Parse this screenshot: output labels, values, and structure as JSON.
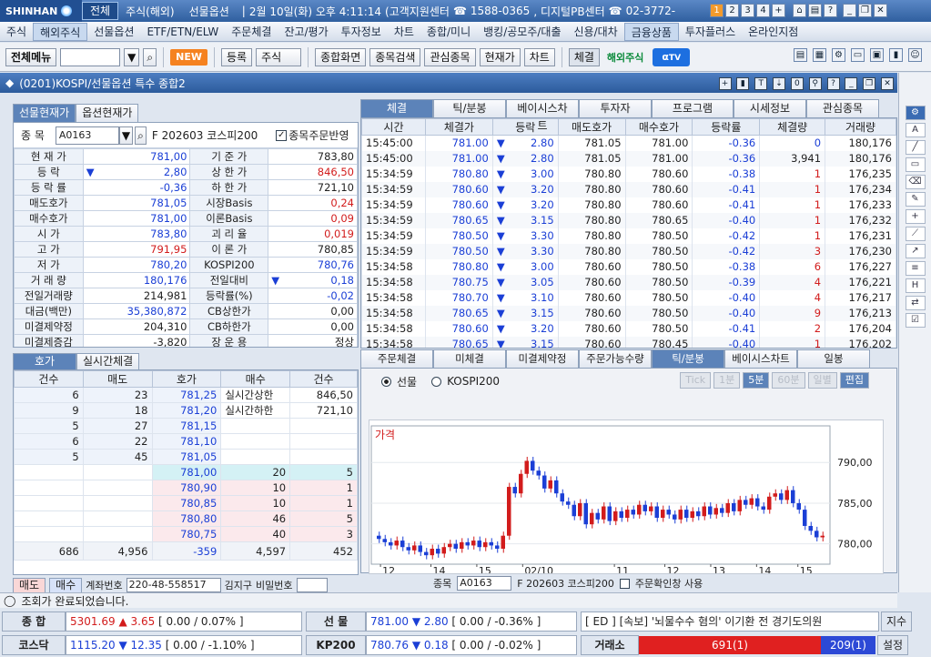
{
  "titlebar": {
    "brand": "SHINHAN",
    "menus": [
      "전체",
      "주식(해외)",
      "선물옵션"
    ],
    "datetime": "2월 10일(화) 오후 4:11:14",
    "center": "(고객지원센터",
    "phone1": "1588-0365",
    "pb": ", 디지털PB센터",
    "phone2": "02-3772-",
    "nums": [
      "1",
      "2",
      "3",
      "4",
      "+"
    ]
  },
  "menubar": [
    "주식",
    "해외주식",
    "선물옵션",
    "ETF/ETN/ELW",
    "주문체결",
    "잔고/평가",
    "투자정보",
    "차트",
    "종합/미니",
    "뱅킹/공모주/대출",
    "신용/대차",
    "금융상품",
    "투자플러스",
    "온라인지점"
  ],
  "toolbar": {
    "all_menu": "전체메뉴",
    "new": "NEW",
    "register": "등록",
    "market": "주식",
    "buttons": [
      "종합화면",
      "종목검색",
      "관심종목",
      "현재가",
      "차트"
    ],
    "check": "체결",
    "overseas": "해외주식",
    "alpha": "TV"
  },
  "window": {
    "title": "(0201)KOSPI/선물옵션 특수 종합2"
  },
  "left_tabs": [
    "선물현재가",
    "옵션현재가"
  ],
  "code": {
    "label": "종 목",
    "value": "A0163",
    "name": "F 202603 코스피200",
    "checkbox": "종목주문반영"
  },
  "quote": [
    [
      "현 재 가",
      "781,00",
      "기 준 가",
      "783,80"
    ],
    [
      "등    락",
      "2,80",
      "상 한 가",
      "846,50"
    ],
    [
      "등 락 률",
      "-0,36",
      "하 한 가",
      "721,10"
    ],
    [
      "매도호가",
      "781,05",
      "시장Basis",
      "0,24"
    ],
    [
      "매수호가",
      "781,00",
      "이론Basis",
      "0,09"
    ],
    [
      "시    가",
      "783,80",
      "괴 리 율",
      "0,019"
    ],
    [
      "고    가",
      "791,95",
      "이 론 가",
      "780,85"
    ],
    [
      "저    가",
      "780,20",
      "KOSPI200",
      "780,76"
    ],
    [
      "거 래 량",
      "180,176",
      "전일대비",
      "0,18"
    ],
    [
      "전일거래량",
      "214,981",
      "등락률(%)",
      "-0,02"
    ],
    [
      "대금(백만)",
      "35,380,872",
      "CB상한가",
      "0,00"
    ],
    [
      "미결제약정",
      "204,310",
      "CB하한가",
      "0,00"
    ],
    [
      "미결제증감",
      "-3,820",
      "장 운 용",
      "정상"
    ]
  ],
  "right_tabs": [
    "체결",
    "틱/분봉",
    "베이시스차트",
    "투자자",
    "프로그램",
    "시세정보",
    "관심종목"
  ],
  "trade_headers": [
    "시간",
    "체결가",
    "등락",
    "매도호가",
    "매수호가",
    "등락률",
    "체결량",
    "거래량"
  ],
  "trades": [
    [
      "15:45:00",
      "781.00",
      "2.80",
      "781.05",
      "781.00",
      "-0.36",
      "0",
      "180,176"
    ],
    [
      "15:45:00",
      "781.00",
      "2.80",
      "781.05",
      "781.00",
      "-0.36",
      "3,941",
      "180,176"
    ],
    [
      "15:34:59",
      "780.80",
      "3.00",
      "780.80",
      "780.60",
      "-0.38",
      "1",
      "176,235"
    ],
    [
      "15:34:59",
      "780.60",
      "3.20",
      "780.80",
      "780.60",
      "-0.41",
      "1",
      "176,234"
    ],
    [
      "15:34:59",
      "780.60",
      "3.20",
      "780.80",
      "780.60",
      "-0.41",
      "1",
      "176,233"
    ],
    [
      "15:34:59",
      "780.65",
      "3.15",
      "780.80",
      "780.65",
      "-0.40",
      "1",
      "176,232"
    ],
    [
      "15:34:59",
      "780.50",
      "3.30",
      "780.80",
      "780.50",
      "-0.42",
      "1",
      "176,231"
    ],
    [
      "15:34:59",
      "780.50",
      "3.30",
      "780.80",
      "780.50",
      "-0.42",
      "3",
      "176,230"
    ],
    [
      "15:34:58",
      "780.80",
      "3.00",
      "780.60",
      "780.50",
      "-0.38",
      "6",
      "176,227"
    ],
    [
      "15:34:58",
      "780.75",
      "3.05",
      "780.60",
      "780.50",
      "-0.39",
      "4",
      "176,221"
    ],
    [
      "15:34:58",
      "780.70",
      "3.10",
      "780.60",
      "780.50",
      "-0.40",
      "4",
      "176,217"
    ],
    [
      "15:34:58",
      "780.65",
      "3.15",
      "780.60",
      "780.50",
      "-0.40",
      "9",
      "176,213"
    ],
    [
      "15:34:58",
      "780.60",
      "3.20",
      "780.60",
      "780.50",
      "-0.41",
      "2",
      "176,204"
    ],
    [
      "15:34:58",
      "780.65",
      "3.15",
      "780.60",
      "780.45",
      "-0.40",
      "1",
      "176,202"
    ]
  ],
  "ob_tabs": [
    "호가",
    "실시간체결"
  ],
  "ob_headers": [
    "건수",
    "매도",
    "호가",
    "매수",
    "건수"
  ],
  "ob_asks": [
    [
      "6",
      "23",
      "781,25"
    ],
    [
      "9",
      "18",
      "781,20"
    ],
    [
      "5",
      "27",
      "781,15"
    ],
    [
      "6",
      "22",
      "781,10"
    ],
    [
      "5",
      "45",
      "781,05"
    ]
  ],
  "ob_limits": [
    [
      "실시간상한",
      "846,50"
    ],
    [
      "실시간하한",
      "721,10"
    ]
  ],
  "ob_bids": [
    [
      "781,00",
      "20",
      "5"
    ],
    [
      "780,90",
      "10",
      "1"
    ],
    [
      "780,85",
      "10",
      "1"
    ],
    [
      "780,80",
      "46",
      "5"
    ],
    [
      "780,75",
      "40",
      "3"
    ]
  ],
  "ob_totals": [
    "686",
    "4,956",
    "-359",
    "4,597",
    "452"
  ],
  "ob_bottom": {
    "sell": "매도",
    "buy": "매수",
    "acct_label": "계좌번호",
    "acct": "220-48-558517",
    "name": "김지구",
    "pw": "비밀번호"
  },
  "chart_tabs": [
    "주문체결",
    "미체결",
    "미결제약정",
    "주문가능수량",
    "틱/분봉",
    "베이시스차트",
    "일봉"
  ],
  "chart_opts": {
    "futures": "선물",
    "kospi": "KOSPI200",
    "buttons": [
      "Tick",
      "1분",
      "5분",
      "60분",
      "일별",
      "편집"
    ]
  },
  "chart_bottom": {
    "code_label": "종목",
    "code": "A0163",
    "name": "F 202603 코스피200",
    "check": "주문확인창 사용"
  },
  "chart_data": {
    "type": "candlestick",
    "title": "가격",
    "xticks": [
      "12",
      "14",
      "15",
      "02/10",
      "11",
      "12",
      "13",
      "14",
      "15"
    ],
    "yticks": [
      "790,00",
      "785,00",
      "780,00"
    ],
    "ylim": [
      777.5,
      794.5
    ],
    "close": [
      780.6,
      780.2,
      779.8,
      780.4,
      779.6,
      779.2,
      779.8,
      779.0,
      778.6,
      779.4,
      778.8,
      779.6,
      780.0,
      779.4,
      780.2,
      779.8,
      780.4,
      779.6,
      780.2,
      779.8,
      779.4,
      781.0,
      787.0,
      786.2,
      788.6,
      790.2,
      789.0,
      788.4,
      786.8,
      787.8,
      786.2,
      785.2,
      784.8,
      783.4,
      785.0,
      782.4,
      783.8,
      783.0,
      784.6,
      782.8,
      784.0,
      783.2,
      784.2,
      783.6,
      784.8,
      784.0,
      784.6,
      783.2,
      784.2,
      783.6,
      783.0,
      784.2,
      783.2,
      784.0,
      783.4,
      784.6,
      783.6,
      784.4,
      783.8,
      785.0,
      784.0,
      785.4,
      784.8,
      785.6,
      784.6,
      784.2,
      785.8,
      786.2,
      785.4,
      786.6,
      785.0,
      784.2,
      782.2,
      781.6,
      780.8,
      781.0
    ]
  },
  "status": "조회가 완료되었습니다.",
  "ticker": {
    "row1": [
      {
        "label": "종  합",
        "value": "5301.69",
        "chg": "▲ 3.65",
        "pct": "[ 0.00  / 0.07% ]"
      },
      {
        "label": "선  물",
        "value": "781.00",
        "chg": "▼ 2.80",
        "pct": "[ 0.00  / -0.36% ]"
      }
    ],
    "news": "[ ED ] [속보] '뇌물수수 혐의' 이기환 전 경기도의원",
    "news_btn": "지수",
    "row2": [
      {
        "label": "코스닥",
        "value": "1115.20",
        "chg": "▼ 12.35",
        "pct": "[ 0.00  / -1.10% ]"
      },
      {
        "label": "KP200",
        "value": "780.76",
        "chg": "▼ 0.18",
        "pct": "[ 0.00  / -0.02% ]"
      }
    ],
    "exchange": "거래소",
    "adv": "691(1)",
    "dec": "209(1)",
    "settings": "설정"
  },
  "colors": {
    "up": "#d21c1c",
    "down": "#1b3fd6",
    "accent": "#5c83b9"
  }
}
